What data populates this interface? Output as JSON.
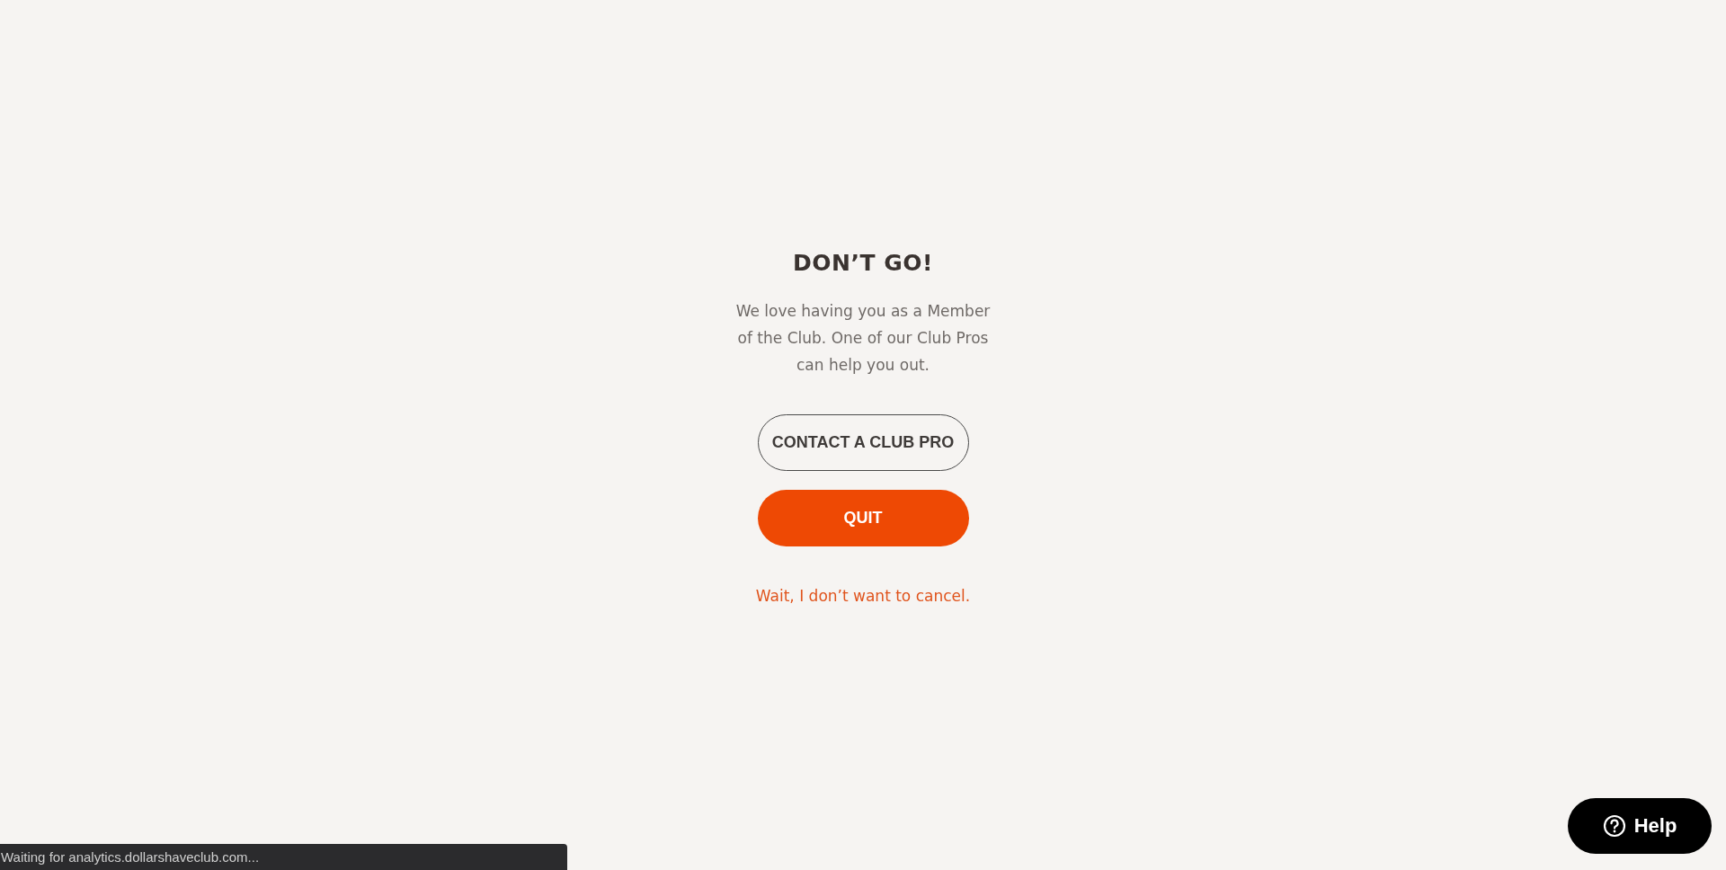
{
  "heading": "DON’T GO!",
  "message": "We love having you as a Member of the Club. One of our Club Pros can help you out.",
  "buttons": [
    {
      "label": "CONTACT A CLUB PRO",
      "kind": "outline"
    },
    {
      "label": "QUIT",
      "kind": "filled"
    }
  ],
  "link": "Wait, I don’t want to cancel.",
  "help_button": {
    "label": "Help"
  },
  "status_bar": "Waiting for analytics.dollarshaveclub.com..."
}
